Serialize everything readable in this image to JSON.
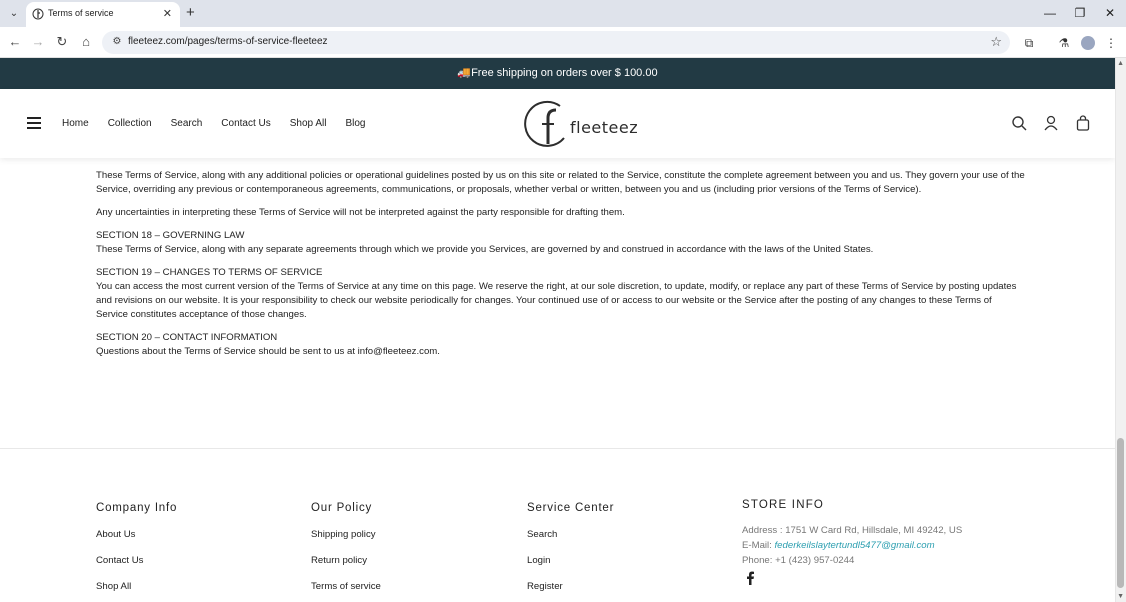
{
  "browser": {
    "tab_title": "Terms of service",
    "url": "fleeteez.com/pages/terms-of-service-fleeteez"
  },
  "announcement": {
    "text": "🚚Free shipping on orders over $ 100.00"
  },
  "header": {
    "nav": [
      "Home",
      "Collection",
      "Search",
      "Contact Us",
      "Shop All",
      "Blog"
    ],
    "logo_text": "fleeteez"
  },
  "content": {
    "p1": "These Terms of Service, along with any additional policies or operational guidelines posted by us on this site or related to the Service, constitute the complete agreement between you and us. They govern your use of the Service, overriding any previous or contemporaneous agreements, communications, or proposals, whether verbal or written, between you and us (including prior versions of the Terms of Service).",
    "p2": "Any uncertainties in interpreting these Terms of Service will not be interpreted against the party responsible for drafting them.",
    "s18_heading": "SECTION 18 – GOVERNING LAW",
    "s18_body": "These Terms of Service, along with any separate agreements through which we provide you Services, are governed by and construed in accordance with the laws of the United States.",
    "s19_heading": "SECTION 19 – CHANGES TO TERMS OF SERVICE",
    "s19_body": "You can access the most current version of the Terms of Service at any time on this page. We reserve the right, at our sole discretion, to update, modify, or replace any part of these Terms of Service by posting updates and revisions on our website. It is your responsibility to check our website periodically for changes. Your continued use of or access to our website or the Service after the posting of any changes to these Terms of Service constitutes acceptance of those changes.",
    "s20_heading": "SECTION 20 – CONTACT INFORMATION",
    "s20_body": "Questions about the Terms of Service should be sent to us at info@fleeteez.com."
  },
  "footer": {
    "company": {
      "title": "Company Info",
      "links": [
        "About Us",
        "Contact Us",
        "Shop All"
      ]
    },
    "policy": {
      "title": "Our Policy",
      "links": [
        "Shipping policy",
        "Return policy",
        "Terms of service"
      ]
    },
    "service": {
      "title": "Service Center",
      "links": [
        "Search",
        "Login",
        "Register"
      ]
    },
    "store": {
      "title": "STORE INFO",
      "address": "Address : 1751 W Card Rd, Hillsdale, MI 49242, US",
      "email_label": "E-Mail: ",
      "email": "federkeilslaytertundl5477@gmail.com",
      "phone": "Phone: +1 (423) 957-0244"
    }
  },
  "colors": {
    "announce_bg": "#223a44",
    "email_link": "#2c9fb0"
  }
}
